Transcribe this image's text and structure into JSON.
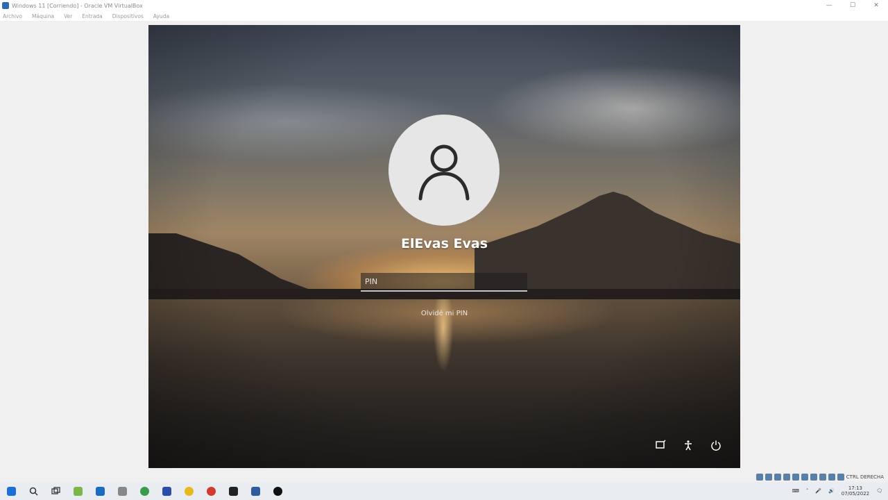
{
  "window": {
    "title": "Windows 11 [Corriendo] - Oracle VM VirtualBox",
    "controls": [
      "—",
      "☐",
      "✕"
    ]
  },
  "menubar": {
    "items": [
      "Archivo",
      "Máquina",
      "Ver",
      "Entrada",
      "Dispositivos",
      "Ayuda"
    ]
  },
  "login": {
    "username": "ElEvas Evas",
    "pin_placeholder": "PIN",
    "forgot_pin": "Olvidé mi PIN"
  },
  "corner_icons": [
    "network-icon",
    "accessibility-icon",
    "power-icon"
  ],
  "taskbar": {
    "icons": [
      {
        "name": "start-icon",
        "color": "#1d6fd8"
      },
      {
        "name": "search-icon",
        "color": "#333333"
      },
      {
        "name": "task-view-icon",
        "color": "#333333"
      },
      {
        "name": "edge-dev-icon",
        "color": "#7ab648"
      },
      {
        "name": "store-icon",
        "color": "#1b6bc1"
      },
      {
        "name": "pen-icon",
        "color": "#888888"
      },
      {
        "name": "chrome-icon",
        "color": "#3a9b4a"
      },
      {
        "name": "remote-desktop-icon",
        "color": "#2b4fa8"
      },
      {
        "name": "chrome-canary-icon",
        "color": "#e8b91c"
      },
      {
        "name": "chrome-beta-icon",
        "color": "#d23b2f"
      },
      {
        "name": "unity-icon",
        "color": "#222222"
      },
      {
        "name": "virtualbox-icon",
        "color": "#2e5d9e"
      },
      {
        "name": "obs-icon",
        "color": "#111111"
      }
    ],
    "status_label": "CTRL DERECHA",
    "clock_time": "17:13",
    "clock_date": "07/05/2022"
  }
}
